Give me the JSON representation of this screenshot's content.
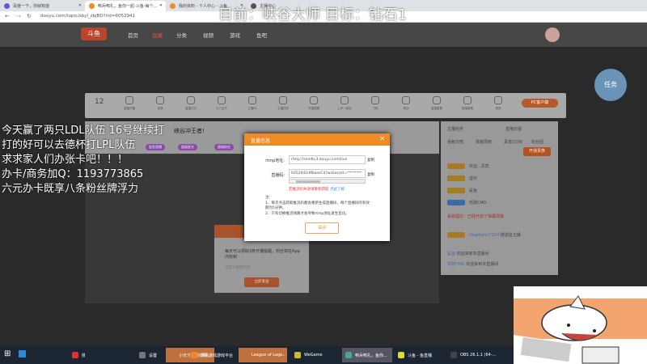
{
  "browser": {
    "tabs": [
      {
        "label": "百度一下，你就知道"
      },
      {
        "label": "鸭兵鸭扎，鱼你一起-斗鱼-每个..."
      },
      {
        "label": "我的资料 - 个人中心 - 斗鱼"
      },
      {
        "label": "主播中心"
      }
    ],
    "url": "douyu.com/topic/sbyl_zbjBD?rid=6052941"
  },
  "overlay": {
    "goal": "目前：峡谷大师 目标：钻石1",
    "lines": [
      "今天赢了两只LDL队伍 16号继续打",
      "打的好可以去德杯打LPL队伍",
      "求求家人们办张卡吧！！！",
      "办卡/商务加Q：1193773865",
      "六元办卡既享八条粉丝牌浮力"
    ]
  },
  "site": {
    "logo": "斗鱼",
    "nav": [
      "首页",
      "直播",
      "分类",
      "视频",
      "游戏",
      "鱼吧"
    ]
  },
  "toolbar": {
    "level": "12",
    "items": [
      "直播开播",
      "音浪",
      "直播日历",
      "火力全开",
      "主播PK",
      "主播任务",
      "开播提醒",
      "上车一起玩",
      "飞机",
      "粉丝",
      "直播数据",
      "直播管理",
      "更多"
    ],
    "pc_button": "PC客户端"
  },
  "room": {
    "title": "峡谷冲王者!",
    "pills": [
      "鲨鱼直播",
      "超级星光",
      "超级粉丝",
      "活动"
    ]
  },
  "right": {
    "links": [
      "主播任务",
      "直播日报"
    ],
    "tabs": [
      "贡献日榜",
      "贡献周榜",
      "贵宾(109)",
      "粉丝团"
    ],
    "open_btn": "开通贵族",
    "users": [
      "欢迎...贵宾",
      "虚中",
      "鲨鱼",
      "驾驶CMG"
    ],
    "system": "系统提示：已经开启了弹幕屏蔽",
    "chat": [
      {
        "name": "Heathenn7314",
        "text": "赠送给主播"
      },
      {
        "name": "鲨鱼",
        "text": "欢迎来到本直播间"
      },
      {
        "name": "驾驶CMG",
        "text": "欢迎来到本直播间"
      }
    ]
  },
  "modal": {
    "title": "直播信息",
    "rtmp_label": "rtmp地址:",
    "rtmp_value": "rtmp://sendtc3.douyu.com/live",
    "key_label": "直播码:",
    "key_value": "6052941rMbaezC4?wsSecret=********",
    "copy": "复制",
    "warn": "若推流码失效请重新获取",
    "warn_link": "点此了解",
    "note_title": "注:",
    "notes": [
      "1、每次点击获取推流码都会重新生成直播码，每个直播码的有效期为5分钟。",
      "2、只有切换推流线路才会导致rtmp地址发生变化。"
    ],
    "close": "关闭"
  },
  "dialog2": {
    "text": "每天可以领取3条开播提醒，粉丝将在App内收到",
    "sub": "自定义提醒内容",
    "button": "立即发送"
  },
  "taskbar": [
    {
      "label": "搜索"
    },
    {
      "label": "小天才去回归啊..."
    },
    {
      "label": "设置"
    },
    {
      "label": "网易游戏游戏平台"
    },
    {
      "label": "League of Lege..."
    },
    {
      "label": "WeGame"
    },
    {
      "label": "鸭兵鸭扎，鱼你..."
    },
    {
      "label": "斗鱼 - 鱼直播"
    },
    {
      "label": "OBS 26.1.1 (64-..."
    }
  ]
}
